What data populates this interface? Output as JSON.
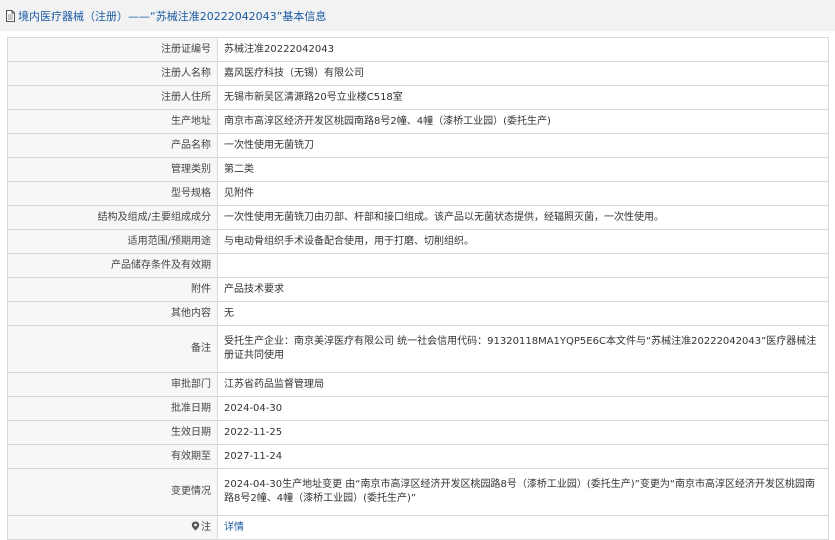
{
  "header": {
    "title": "境内医疗器械（注册）——“苏械注准20222042043”基本信息"
  },
  "rows": [
    {
      "label": "注册证编号",
      "value": "苏械注准20222042043"
    },
    {
      "label": "注册人名称",
      "value": "嘉风医疗科技（无锡）有限公司"
    },
    {
      "label": "注册人住所",
      "value": "无锡市新吴区清源路20号立业楼C518室"
    },
    {
      "label": "生产地址",
      "value": "南京市高淳区经济开发区桃园南路8号2幢、4幢（漆桥工业园）(委托生产)"
    },
    {
      "label": "产品名称",
      "value": "一次性使用无菌铣刀"
    },
    {
      "label": "管理类别",
      "value": "第二类"
    },
    {
      "label": "型号规格",
      "value": "见附件"
    },
    {
      "label": "结构及组成/主要组成成分",
      "value": "一次性使用无菌铣刀由刃部、杆部和接口组成。该产品以无菌状态提供，经辐照灭菌，一次性使用。"
    },
    {
      "label": "适用范围/预期用途",
      "value": "与电动骨组织手术设备配合使用，用于打磨、切削组织。"
    },
    {
      "label": "产品储存条件及有效期",
      "value": ""
    },
    {
      "label": "附件",
      "value": "产品技术要求"
    },
    {
      "label": "其他内容",
      "value": "无"
    },
    {
      "label": "备注",
      "value": "受托生产企业：南京美淳医疗有限公司 统一社会信用代码：91320118MA1YQP5E6C本文件与“苏械注准20222042043”医疗器械注册证共同使用"
    },
    {
      "label": "审批部门",
      "value": "江苏省药品监督管理局"
    },
    {
      "label": "批准日期",
      "value": "2024-04-30"
    },
    {
      "label": "生效日期",
      "value": "2022-11-25"
    },
    {
      "label": "有效期至",
      "value": "2027-11-24"
    },
    {
      "label": "变更情况",
      "value": "2024-04-30生产地址变更 由“南京市高淳区经济开发区桃园路8号（漆桥工业园）(委托生产)”变更为“南京市高淳区经济开发区桃园南路8号2幢、4幢（漆桥工业园）(委托生产)”"
    }
  ],
  "note_row": {
    "label": "注",
    "icon": "location-pin-icon",
    "link_text": "详情"
  },
  "colors": {
    "title_bar_bg": "#f2f2f2",
    "title_text": "#1a5aa3",
    "label_bg": "#f7f7f7",
    "border": "#d9d9d9",
    "link": "#1a5aa3"
  }
}
